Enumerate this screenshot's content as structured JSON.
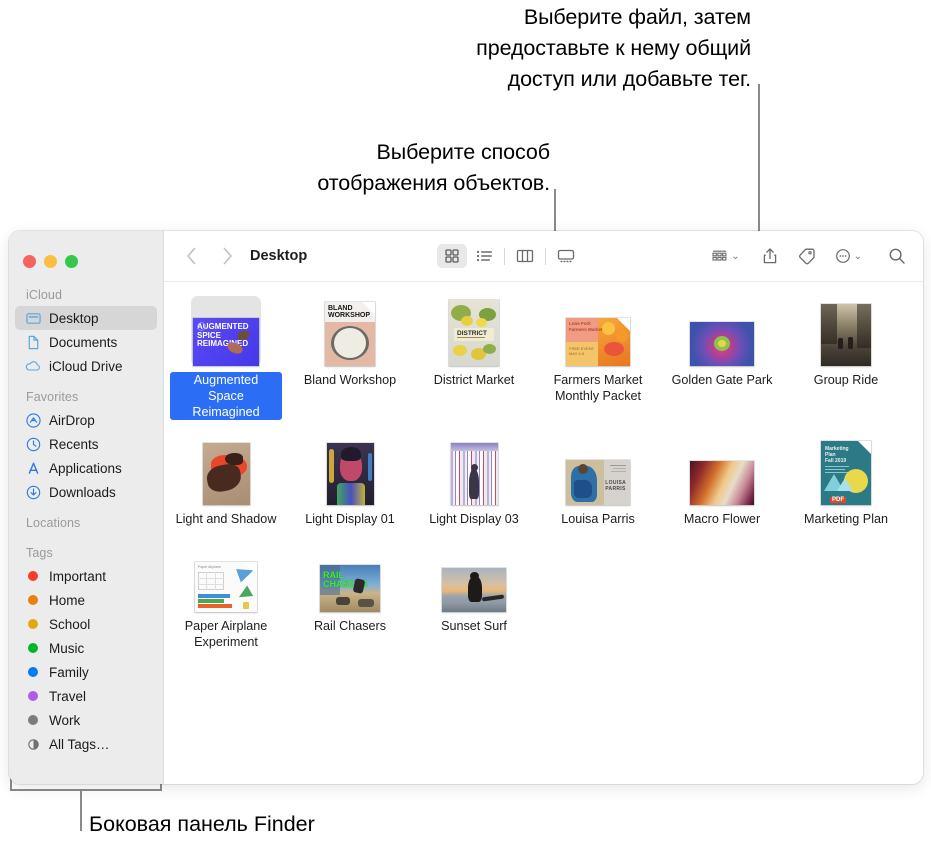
{
  "annotations": {
    "top": "Выберите файл, затем\nпредоставьте к нему общий\nдоступ или добавьте тег.",
    "middle": "Выберите способ\nотображения объектов.",
    "bottom": "Боковая панель Finder"
  },
  "window": {
    "title": "Desktop",
    "traffic_lights": [
      "close",
      "minimize",
      "zoom"
    ]
  },
  "sidebar": {
    "sections": [
      {
        "label": "iCloud",
        "items": [
          {
            "label": "Desktop",
            "icon": "desktop-icon",
            "selected": true
          },
          {
            "label": "Documents",
            "icon": "document-icon",
            "selected": false
          },
          {
            "label": "iCloud Drive",
            "icon": "cloud-icon",
            "selected": false
          }
        ]
      },
      {
        "label": "Favorites",
        "items": [
          {
            "label": "AirDrop",
            "icon": "airdrop-icon",
            "selected": false
          },
          {
            "label": "Recents",
            "icon": "clock-icon",
            "selected": false
          },
          {
            "label": "Applications",
            "icon": "appstore-icon",
            "selected": false
          },
          {
            "label": "Downloads",
            "icon": "download-icon",
            "selected": false
          }
        ]
      },
      {
        "label": "Locations",
        "items": []
      },
      {
        "label": "Tags",
        "items": [
          {
            "label": "Important",
            "icon": "tag-dot",
            "color": "#fc3b2d",
            "selected": false
          },
          {
            "label": "Home",
            "icon": "tag-dot",
            "color": "#e8820c",
            "selected": false
          },
          {
            "label": "School",
            "icon": "tag-dot",
            "color": "#e0aa0f",
            "selected": false
          },
          {
            "label": "Music",
            "icon": "tag-dot",
            "color": "#00b52a",
            "selected": false
          },
          {
            "label": "Family",
            "icon": "tag-dot",
            "color": "#007bfb",
            "selected": false
          },
          {
            "label": "Travel",
            "icon": "tag-dot",
            "color": "#b05ce6",
            "selected": false
          },
          {
            "label": "Work",
            "icon": "tag-dot",
            "color": "#7c7c80",
            "selected": false
          },
          {
            "label": "All Tags…",
            "icon": "all-tags-icon",
            "selected": false
          }
        ]
      }
    ]
  },
  "toolbar": {
    "back": "‹",
    "forward": "›",
    "view_modes": [
      {
        "name": "icon-view",
        "active": true
      },
      {
        "name": "list-view",
        "active": false
      },
      {
        "name": "column-view",
        "active": false
      },
      {
        "name": "gallery-view",
        "active": false
      }
    ],
    "group_by": "group-by-icon",
    "share": "share-icon",
    "tag": "tag-icon",
    "more": "more-actions-icon",
    "search": "search-icon"
  },
  "files": [
    {
      "name": "Augmented\nSpace Reimagined",
      "selected": true,
      "kind": "image-wide",
      "thumb": "augmented"
    },
    {
      "name": "Bland Workshop",
      "selected": false,
      "kind": "doc-tall",
      "thumb": "bland"
    },
    {
      "name": "District Market",
      "selected": false,
      "kind": "image-tall",
      "thumb": "district"
    },
    {
      "name": "Farmers Market\nMonthly Packet",
      "selected": false,
      "kind": "doc-wide",
      "thumb": "farmers"
    },
    {
      "name": "Golden Gate Park",
      "selected": false,
      "kind": "image-wide",
      "thumb": "flower"
    },
    {
      "name": "Group Ride",
      "selected": false,
      "kind": "image-tall",
      "thumb": "groupride"
    },
    {
      "name": "Light and Shadow",
      "selected": false,
      "kind": "image-tall",
      "thumb": "lightshadow"
    },
    {
      "name": "Light Display 01",
      "selected": false,
      "kind": "image-tall",
      "thumb": "display01"
    },
    {
      "name": "Light Display 03",
      "selected": false,
      "kind": "image-tall",
      "thumb": "display03"
    },
    {
      "name": "Louisa Parris",
      "selected": false,
      "kind": "image-wide",
      "thumb": "louisa"
    },
    {
      "name": "Macro Flower",
      "selected": false,
      "kind": "image-wide",
      "thumb": "macro"
    },
    {
      "name": "Marketing Plan",
      "selected": false,
      "kind": "pdf-tall",
      "thumb": "marketing"
    },
    {
      "name": "Paper Airplane\nExperiment",
      "selected": false,
      "kind": "doc-wide",
      "thumb": "paper"
    },
    {
      "name": "Rail Chasers",
      "selected": false,
      "kind": "image-wide",
      "thumb": "rail"
    },
    {
      "name": "Sunset Surf",
      "selected": false,
      "kind": "image-wide",
      "thumb": "sunset"
    }
  ]
}
